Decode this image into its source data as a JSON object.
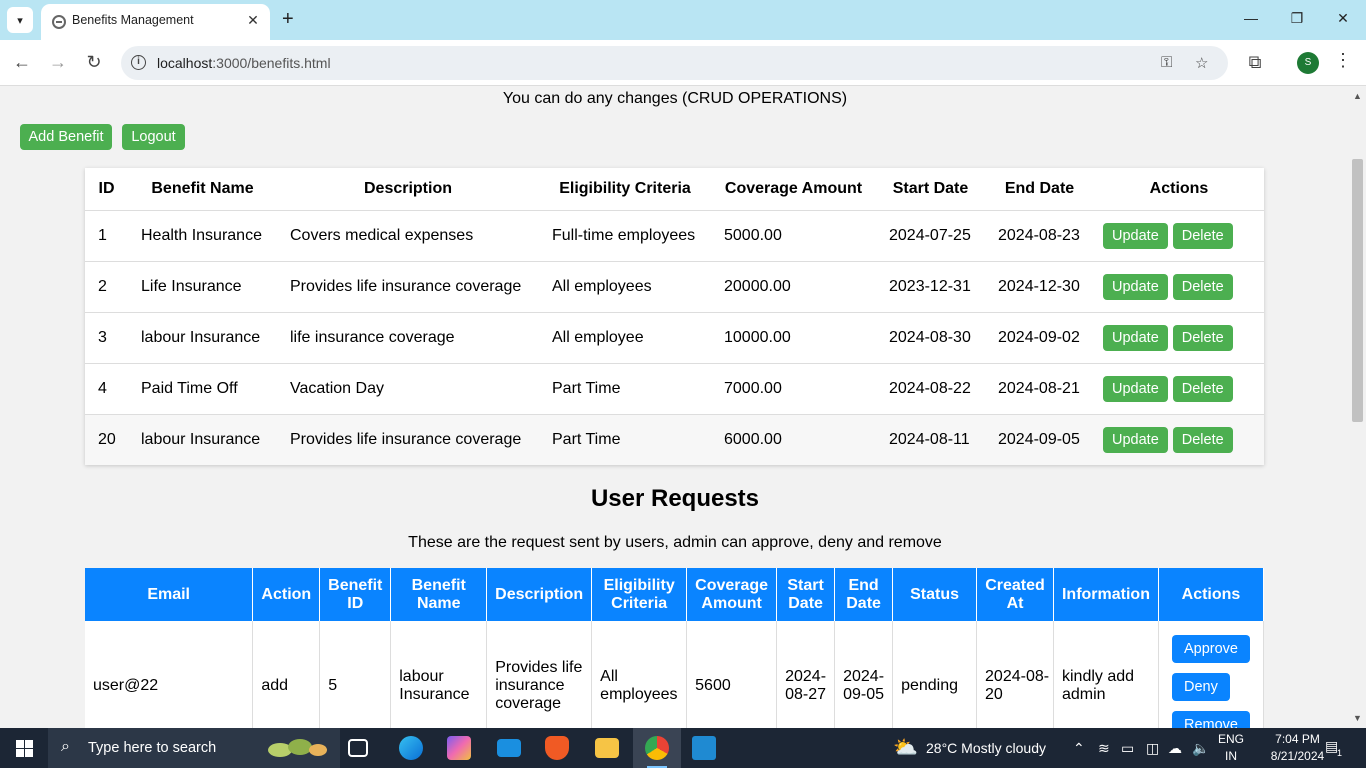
{
  "browser": {
    "tab_title": "Benefits Management",
    "url_host": "localhost",
    "url_path": ":3000/benefits.html"
  },
  "page": {
    "intro_text": "You can do any changes (CRUD OPERATIONS)",
    "add_benefit_label": "Add Benefit",
    "logout_label": "Logout",
    "update_label": "Update",
    "delete_label": "Delete",
    "benefits_headers": [
      "ID",
      "Benefit Name",
      "Description",
      "Eligibility Criteria",
      "Coverage Amount",
      "Start Date",
      "End Date",
      "Actions"
    ],
    "benefits": [
      {
        "id": "1",
        "name": "Health Insurance",
        "description": "Covers medical expenses",
        "eligibility": "Full-time employees",
        "coverage": "5000.00",
        "start": "2024-07-25",
        "end": "2024-08-23"
      },
      {
        "id": "2",
        "name": "Life Insurance",
        "description": "Provides life insurance coverage",
        "eligibility": "All employees",
        "coverage": "20000.00",
        "start": "2023-12-31",
        "end": "2024-12-30"
      },
      {
        "id": "3",
        "name": "labour Insurance",
        "description": "life insurance coverage",
        "eligibility": "All employee",
        "coverage": "10000.00",
        "start": "2024-08-30",
        "end": "2024-09-02"
      },
      {
        "id": "4",
        "name": "Paid Time Off",
        "description": "Vacation Day",
        "eligibility": "Part Time",
        "coverage": "7000.00",
        "start": "2024-08-22",
        "end": "2024-08-21"
      },
      {
        "id": "20",
        "name": "labour Insurance",
        "description": "Provides life insurance coverage",
        "eligibility": "Part Time",
        "coverage": "6000.00",
        "start": "2024-08-11",
        "end": "2024-09-05"
      }
    ],
    "requests_title": "User Requests",
    "requests_subtitle": "These are the request sent by users, admin can approve, deny and remove",
    "requests_headers": [
      "Email",
      "Action",
      "Benefit ID",
      "Benefit Name",
      "Description",
      "Eligibility Criteria",
      "Coverage Amount",
      "Start Date",
      "End Date",
      "Status",
      "Created At",
      "Information",
      "Actions"
    ],
    "requests": [
      {
        "email": "user@22",
        "action": "add",
        "benefit_id": "5",
        "benefit_name": "labour Insurance",
        "description": "Provides life insurance coverage",
        "eligibility": "All employees",
        "coverage": "5600",
        "start": "2024-08-27",
        "end": "2024-09-05",
        "status": "pending",
        "created_at": "2024-08-20",
        "information": "kindly add admin"
      }
    ],
    "approve_label": "Approve",
    "deny_label": "Deny",
    "remove_label": "Remove"
  },
  "taskbar": {
    "search_placeholder": "Type here to search",
    "weather": "28°C  Mostly cloudy",
    "lang_top": "ENG",
    "lang_bottom": "IN",
    "time": "7:04 PM",
    "date": "8/21/2024",
    "notification_count": "1"
  },
  "colors": {
    "green": "#4caf50",
    "blue": "#0a84ff",
    "tabbar": "#b9e5f3"
  }
}
